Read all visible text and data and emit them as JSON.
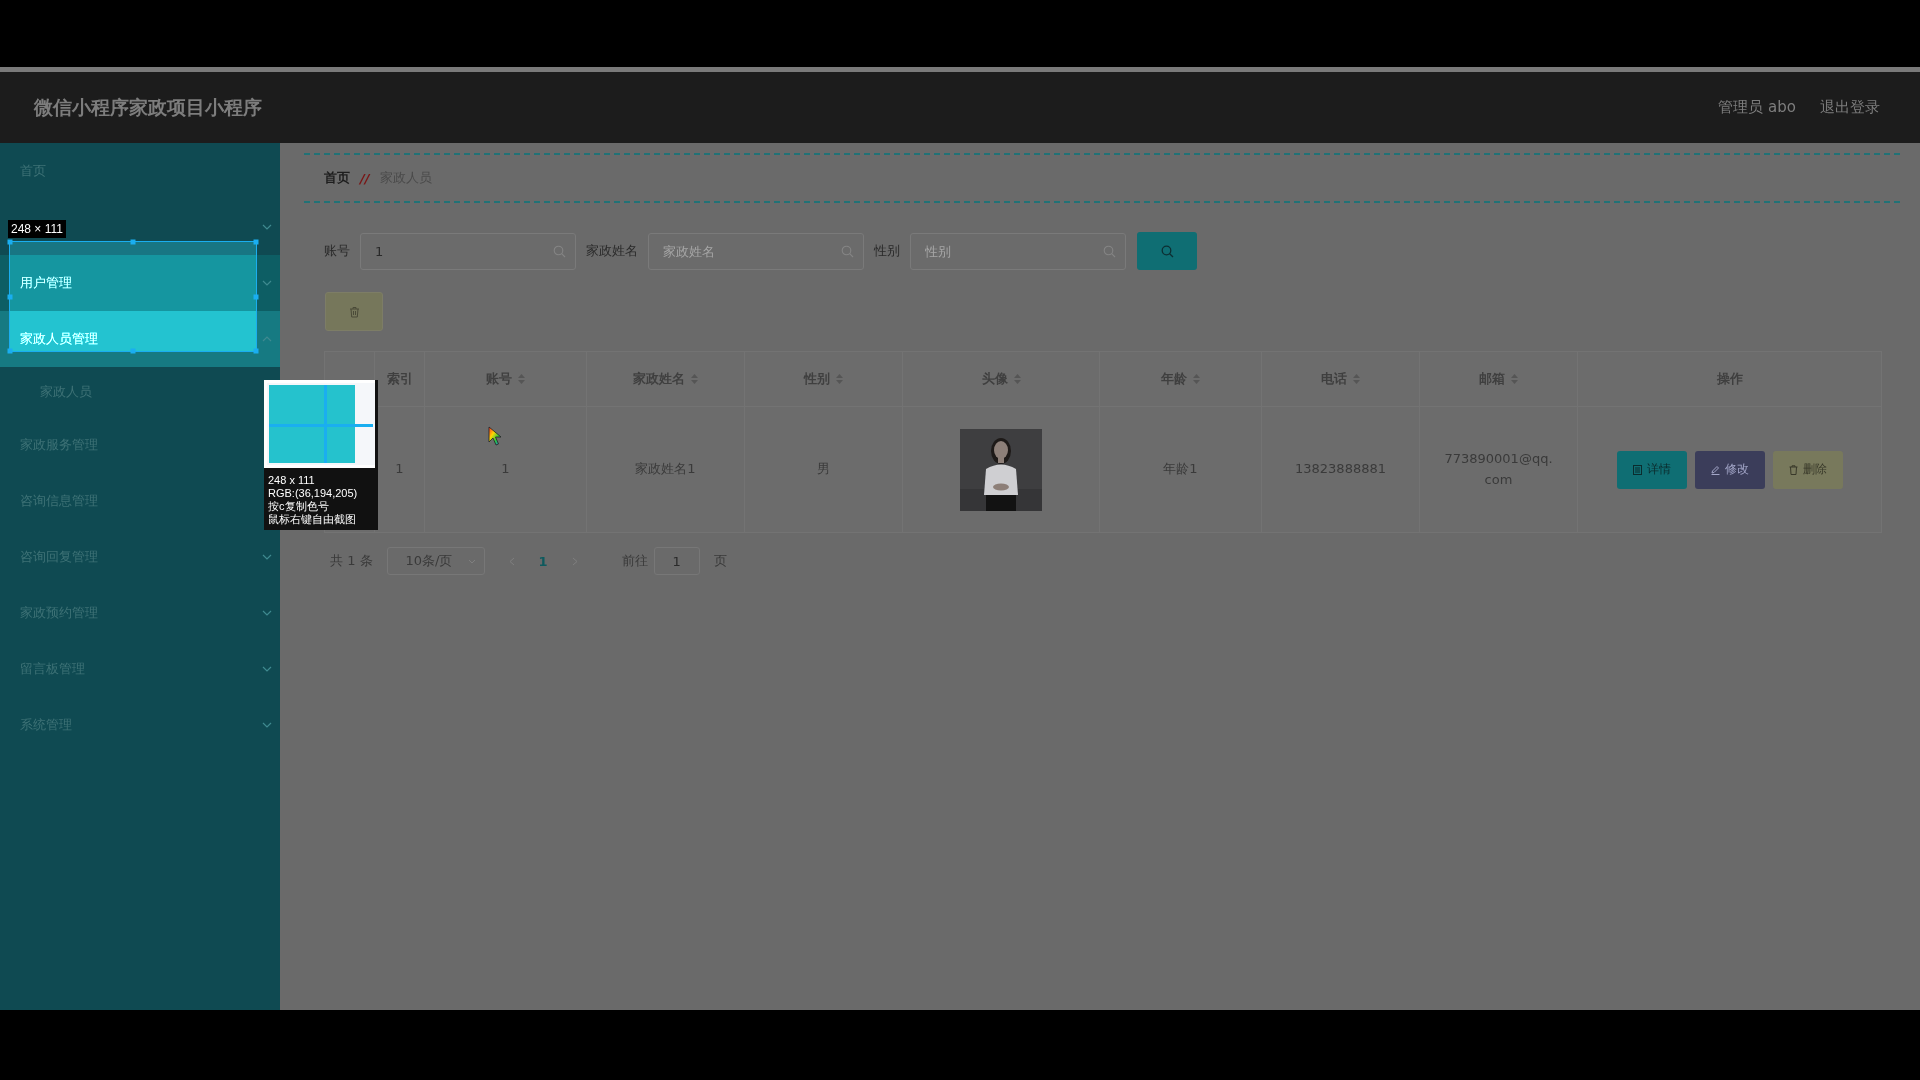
{
  "header": {
    "title": "微信小程序家政项目小程序",
    "user": "管理员 abo",
    "logout": "退出登录"
  },
  "sidebar": {
    "items": [
      {
        "label": "首页",
        "selected": false
      },
      {
        "expanded": false
      },
      {
        "label": "用户管理",
        "selected": false,
        "expanded": false
      },
      {
        "label": "家政人员管理",
        "selected": true,
        "expanded": true,
        "children": [
          {
            "label": "家政人员",
            "selected": false
          }
        ]
      },
      {
        "label": "家政服务管理",
        "selected": false
      },
      {
        "label": "咨询信息管理",
        "selected": false
      },
      {
        "label": "咨询回复管理",
        "selected": false,
        "expanded": false
      },
      {
        "label": "家政预约管理",
        "selected": false,
        "expanded": false
      },
      {
        "label": "留言板管理",
        "selected": false,
        "expanded": false
      },
      {
        "label": "系统管理",
        "selected": false,
        "expanded": false
      }
    ]
  },
  "breadcrumb": {
    "items": [
      "首页",
      "家政人员"
    ],
    "separator": "//"
  },
  "search": {
    "fields": [
      {
        "label": "账号",
        "value": "1"
      },
      {
        "label": "家政姓名",
        "placeholder": "家政姓名"
      },
      {
        "label": "性别",
        "placeholder": "性别"
      }
    ]
  },
  "table": {
    "columns": [
      {
        "sortable": false
      },
      {
        "label": "索引",
        "sortable": false
      },
      {
        "label": "账号",
        "sortable": true
      },
      {
        "label": "家政姓名",
        "sortable": true
      },
      {
        "label": "性别",
        "sortable": true
      },
      {
        "label": "头像",
        "sortable": true
      },
      {
        "label": "年龄",
        "sortable": true
      },
      {
        "label": "电话",
        "sortable": true
      },
      {
        "label": "邮箱",
        "sortable": true
      },
      {
        "label": "操作",
        "sortable": false
      }
    ],
    "rows": [
      {
        "cells": [
          "",
          "1",
          "1",
          "家政姓名1",
          "男",
          {
            "kind": "picture"
          },
          "年龄1",
          "13823888881",
          "773890001@qq.com"
        ],
        "actions": [
          {
            "kind": "detail",
            "label": "详情"
          },
          {
            "kind": "edit",
            "label": "修改"
          },
          {
            "kind": "delete",
            "label": "删除"
          }
        ]
      }
    ]
  },
  "pagination": {
    "total": "共 1 条",
    "page_size": "10条/页",
    "pages": [
      {
        "label": "1",
        "selected": true
      }
    ],
    "goto_label": "前往",
    "goto_value": "1",
    "goto_suffix": "页"
  },
  "capture_tool": {
    "size_label": "248 × 111",
    "info": [
      "248 x 111",
      "RGB:(36,194,205)",
      "按c复制色号",
      "鼠标右键自由截图"
    ]
  }
}
